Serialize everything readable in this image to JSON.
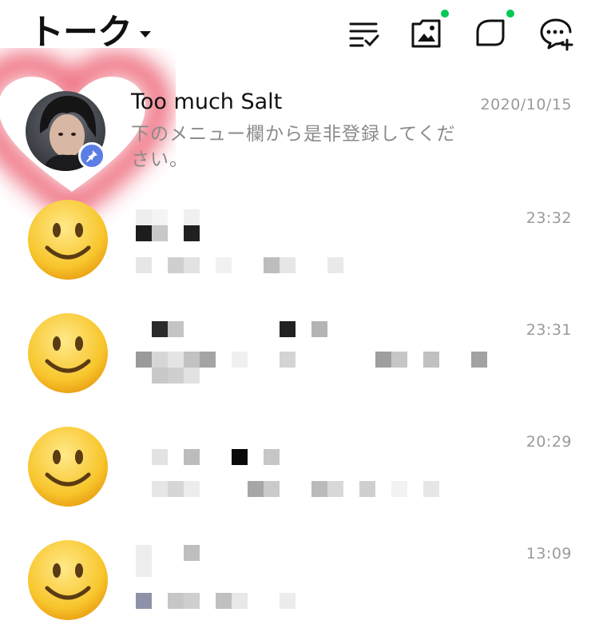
{
  "header": {
    "title": "トーク",
    "icons": [
      "edit-list-icon",
      "album-icon",
      "chat-room-icon",
      "new-chat-icon"
    ],
    "accent_dot_color": "#06c755"
  },
  "chats": [
    {
      "name": "Too much Salt",
      "time": "2020/10/15",
      "preview": "下のメニュー欄から是非登録してください。",
      "pinned": true,
      "avatar": "profile-photo"
    },
    {
      "name": "",
      "time": "23:32",
      "preview": "",
      "avatar": "smiley-emoji"
    },
    {
      "name": "",
      "time": "23:31",
      "preview": "",
      "avatar": "smiley-emoji"
    },
    {
      "name": "",
      "time": "20:29",
      "preview": "",
      "avatar": "smiley-emoji"
    },
    {
      "name": "",
      "time": "13:09",
      "preview": "",
      "avatar": "smiley-emoji"
    }
  ],
  "colors": {
    "pin_badge": "#5b7ee6",
    "heart_glow": "#e8384f"
  }
}
